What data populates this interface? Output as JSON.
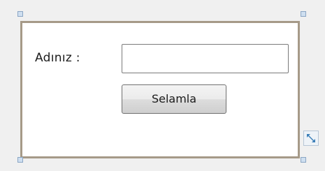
{
  "form": {
    "name_label": "Adınız :",
    "name_input_value": "",
    "name_input_placeholder": "",
    "greet_button_label": "Selamla"
  },
  "designer": {
    "frame_border_color": "#a69a88",
    "handle_color": "#cfdff0",
    "resize_icon": "expand-diagonal-icon"
  }
}
